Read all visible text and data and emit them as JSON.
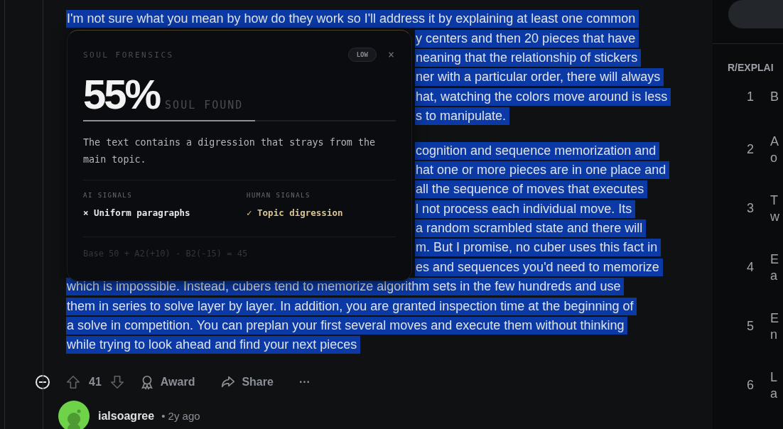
{
  "comment": {
    "paragraphs": [
      {
        "lines": [
          {
            "covered": false,
            "text": "I'm not sure what you mean by how do they work so I'll address it by explaining at least one common"
          },
          {
            "covered": true,
            "text": "y centers and then 20 pieces that have"
          },
          {
            "covered": true,
            "text": "neaning that the relationship of stickers"
          },
          {
            "covered": true,
            "text": "ner with a particular order, there will always"
          },
          {
            "covered": true,
            "text": "hat, watching the colors move around is less"
          },
          {
            "covered": true,
            "text": "s to manipulate."
          }
        ]
      },
      {
        "lines": [
          {
            "covered": true,
            "text": "cognition and sequence memorization and"
          },
          {
            "covered": true,
            "text": "hat one or more pieces are in one place and"
          },
          {
            "covered": true,
            "text": "all the sequence of moves that executes"
          },
          {
            "covered": true,
            "text": "l not process each individual move. Its"
          },
          {
            "covered": true,
            "text": "a random scrambled state and there will"
          },
          {
            "covered": true,
            "text": "m. But I promise, no cuber uses this fact in"
          },
          {
            "covered": true,
            "text": "es and sequences you'd need to memorize"
          },
          {
            "covered": false,
            "text": "which is impossible. Instead, cubers tend to memorize algorithm sets in the few hundreds and use"
          },
          {
            "covered": false,
            "text": "them in series to solve layer by layer. In addition, you are granted inspection time at the beginning of"
          },
          {
            "covered": false,
            "text": "a solve in competition. You can preplan your first several moves and execute them without thinking"
          },
          {
            "covered": false,
            "text": "while trying to look ahead and find your next pieces"
          }
        ]
      }
    ],
    "actions": {
      "votes": "41",
      "award": "Award",
      "share": "Share",
      "more": "···"
    }
  },
  "popover": {
    "title": "SOUL FORENSICS",
    "badge": "LOW",
    "close": "×",
    "score": "55%",
    "score_label": "SOUL FOUND",
    "level": 0.55,
    "summary": "The text contains a digression that strays from the main topic.",
    "signals": [
      {
        "heading": "AI SIGNALS",
        "items": [
          {
            "kind": "ai",
            "mark": "×",
            "text": "Uniform paragraphs"
          }
        ]
      },
      {
        "heading": "HUMAN SIGNALS",
        "items": [
          {
            "kind": "human",
            "mark": "✓",
            "text": "Topic digression"
          }
        ]
      }
    ],
    "formula": "Base 50 + A2(+10) - B2(-15) = 45"
  },
  "reply": {
    "author": "ialsoagree",
    "age": "• 2y ago"
  },
  "sidebar": {
    "heading": "R/EXPLAI",
    "items": [
      {
        "rank": "1",
        "lines": [
          "B"
        ]
      },
      {
        "rank": "2",
        "lines": [
          "A",
          "o"
        ]
      },
      {
        "rank": "3",
        "lines": [
          "T",
          "w"
        ]
      },
      {
        "rank": "4",
        "lines": [
          "E",
          "a"
        ]
      },
      {
        "rank": "5",
        "lines": [
          "E",
          "n"
        ]
      },
      {
        "rank": "6",
        "lines": [
          "L",
          "a"
        ]
      }
    ]
  }
}
